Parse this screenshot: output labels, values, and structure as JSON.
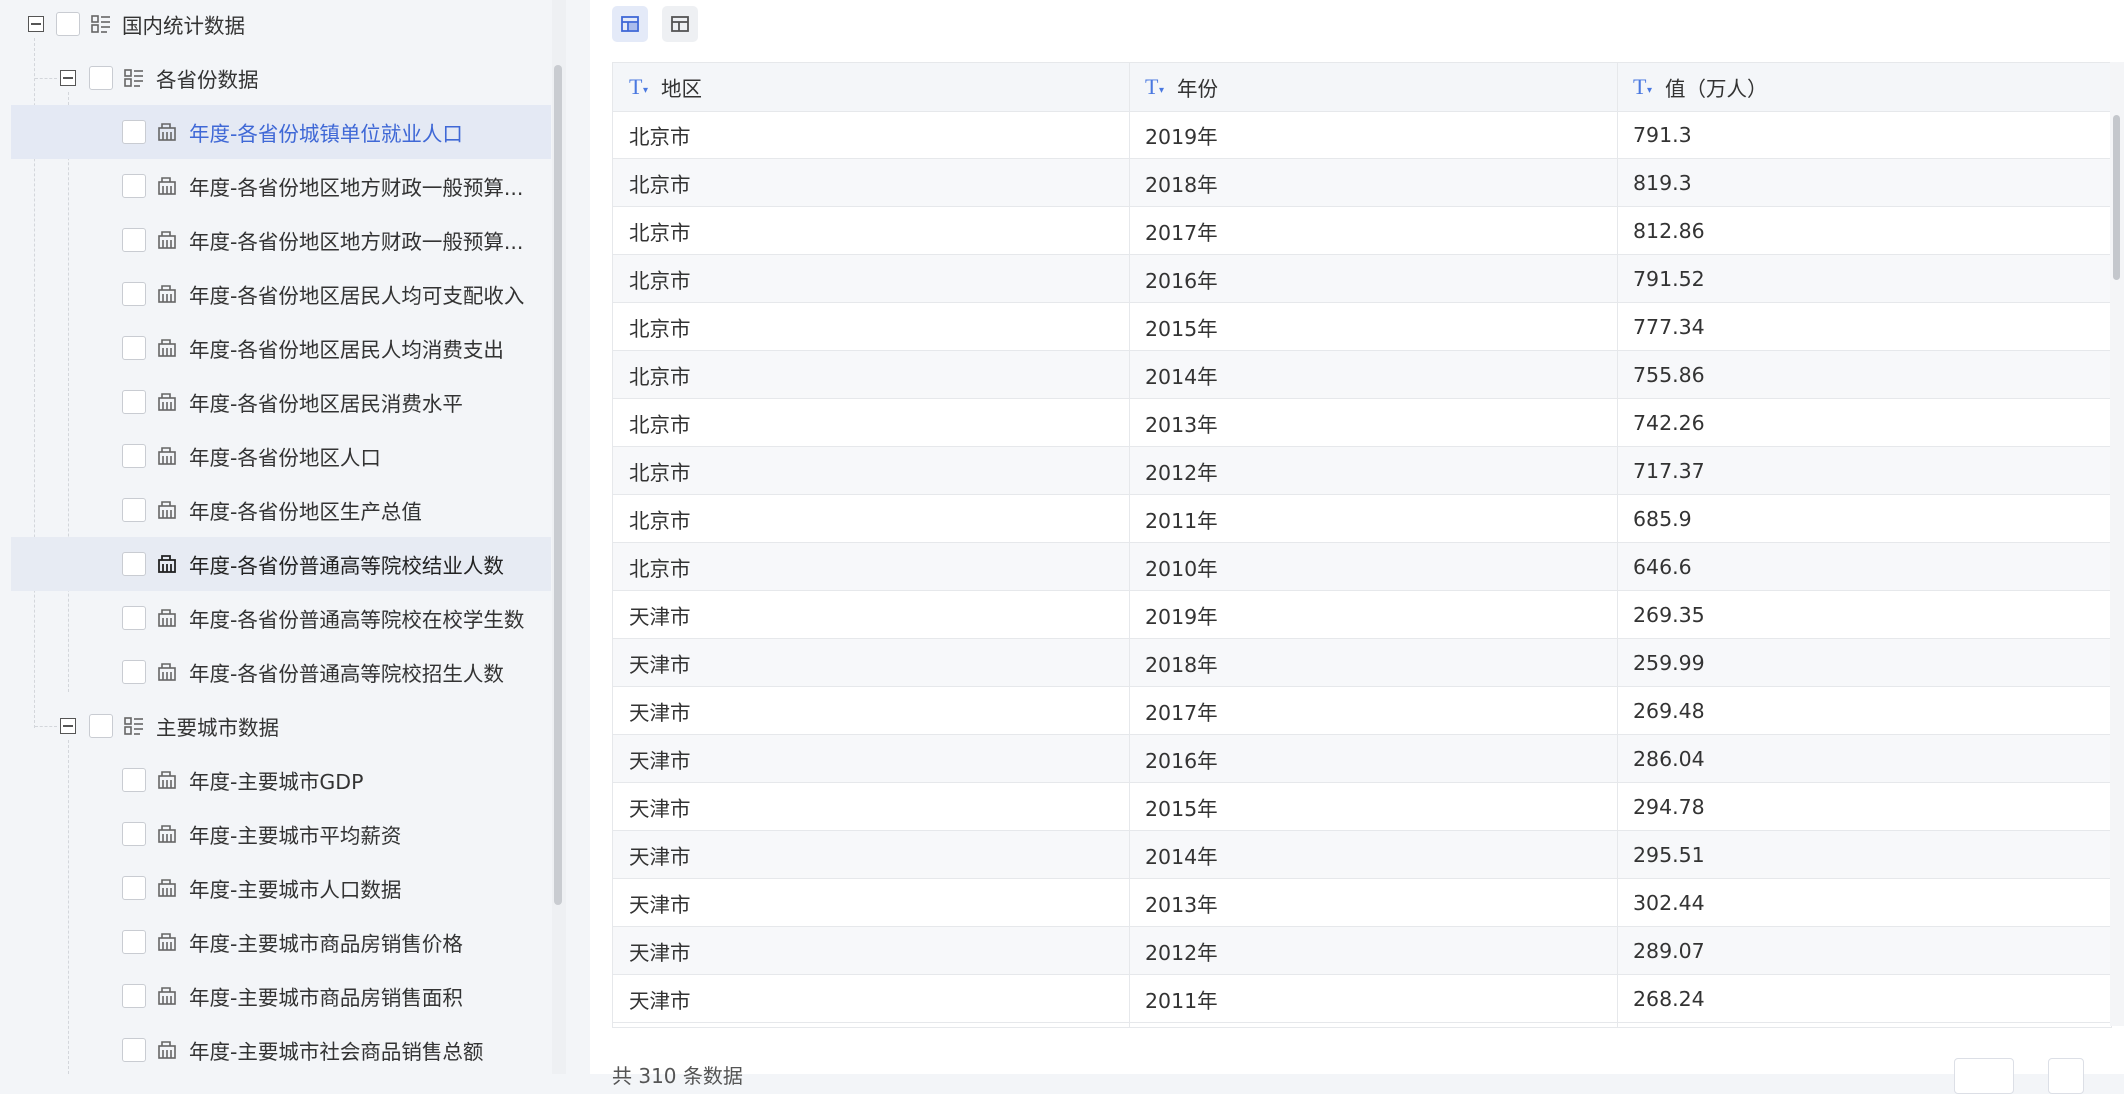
{
  "tree": {
    "root": {
      "label": "国内统计数据"
    },
    "groups": [
      {
        "label": "各省份数据",
        "items": [
          "年度-各省份城镇单位就业人口",
          "年度-各省份地区地方财政一般预算...",
          "年度-各省份地区地方财政一般预算...",
          "年度-各省份地区居民人均可支配收入",
          "年度-各省份地区居民人均消费支出",
          "年度-各省份地区居民消费水平",
          "年度-各省份地区人口",
          "年度-各省份地区生产总值",
          "年度-各省份普通高等院校结业人数",
          "年度-各省份普通高等院校在校学生数",
          "年度-各省份普通高等院校招生人数"
        ]
      },
      {
        "label": "主要城市数据",
        "items": [
          "年度-主要城市GDP",
          "年度-主要城市平均薪资",
          "年度-主要城市人口数据",
          "年度-主要城市商品房销售价格",
          "年度-主要城市商品房销售面积",
          "年度-主要城市社会商品销售总额"
        ]
      }
    ]
  },
  "table": {
    "columns": [
      {
        "type_icon": "T",
        "label": "地区"
      },
      {
        "type_icon": "T",
        "label": "年份"
      },
      {
        "type_icon": "T",
        "label": "值（万人）"
      }
    ],
    "rows": [
      [
        "北京市",
        "2019年",
        "791.3"
      ],
      [
        "北京市",
        "2018年",
        "819.3"
      ],
      [
        "北京市",
        "2017年",
        "812.86"
      ],
      [
        "北京市",
        "2016年",
        "791.52"
      ],
      [
        "北京市",
        "2015年",
        "777.34"
      ],
      [
        "北京市",
        "2014年",
        "755.86"
      ],
      [
        "北京市",
        "2013年",
        "742.26"
      ],
      [
        "北京市",
        "2012年",
        "717.37"
      ],
      [
        "北京市",
        "2011年",
        "685.9"
      ],
      [
        "北京市",
        "2010年",
        "646.6"
      ],
      [
        "天津市",
        "2019年",
        "269.35"
      ],
      [
        "天津市",
        "2018年",
        "259.99"
      ],
      [
        "天津市",
        "2017年",
        "269.48"
      ],
      [
        "天津市",
        "2016年",
        "286.04"
      ],
      [
        "天津市",
        "2015年",
        "294.78"
      ],
      [
        "天津市",
        "2014年",
        "295.51"
      ],
      [
        "天津市",
        "2013年",
        "302.44"
      ],
      [
        "天津市",
        "2012年",
        "289.07"
      ],
      [
        "天津市",
        "2011年",
        "268.24"
      ]
    ]
  },
  "footer": {
    "total_text": "共 310 条数据"
  },
  "colors": {
    "accent": "#3f68d6",
    "selected_bg": "#e4e9f4",
    "panel_bg": "#f3f5f8"
  }
}
